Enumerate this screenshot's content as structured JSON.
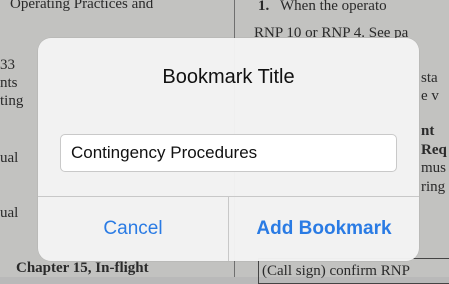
{
  "background_document": {
    "lines": [
      {
        "text": "Operating Practices and",
        "bold": false
      },
      {
        "text": "1.",
        "bold": true
      },
      {
        "text": "When the operato",
        "bold": false
      },
      {
        "text": "RNP 10 or RNP 4. See pa",
        "bold": false
      },
      {
        "text": "33",
        "bold": false
      },
      {
        "text": "nts",
        "bold": false
      },
      {
        "text": "ting",
        "bold": false
      },
      {
        "text": "sta",
        "bold": false
      },
      {
        "text": "e v",
        "bold": false
      },
      {
        "text": "nt",
        "bold": true
      },
      {
        "text": "Req",
        "bold": true
      },
      {
        "text": "mus",
        "bold": false
      },
      {
        "text": "ring",
        "bold": false
      },
      {
        "text": "ual",
        "bold": false
      },
      {
        "text": "ual",
        "bold": false
      },
      {
        "text": "Chapter 15, In-flight",
        "bold": true
      },
      {
        "text": "(Call sign) confirm RNP",
        "bold": false
      }
    ]
  },
  "dialog": {
    "title": "Bookmark Title",
    "field_value": "Contingency Procedures",
    "cancel_label": "Cancel",
    "confirm_label": "Add Bookmark",
    "accent_color": "#2a7be4"
  }
}
